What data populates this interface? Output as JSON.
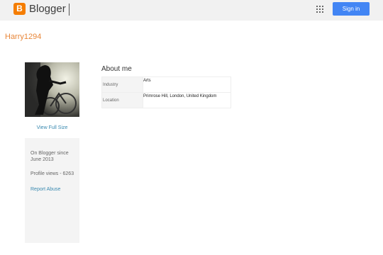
{
  "header": {
    "brand": "Blogger",
    "sign_in_label": "Sign in",
    "apps_icon": "grid-apps-icon",
    "colors": {
      "bar_bg": "#f1f1f1",
      "brand_orange": "#f57d00",
      "signin_blue": "#4285f4"
    }
  },
  "profile": {
    "username": "Harry1294",
    "view_full_size": "View Full Size",
    "on_blogger_since": "On Blogger since June 2013",
    "profile_views": "Profile views - 6263",
    "report_abuse": "Report Abuse"
  },
  "about": {
    "title": "About me",
    "rows": [
      {
        "label": "Industry",
        "value": "Arts"
      },
      {
        "label": "Location",
        "value": "Primrose Hill, London, United Kingdom"
      }
    ]
  }
}
